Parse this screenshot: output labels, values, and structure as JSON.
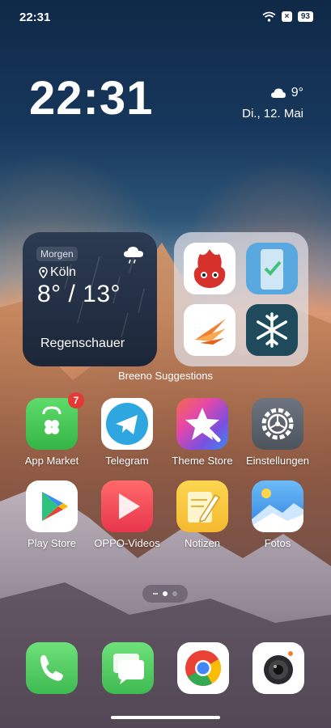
{
  "status_bar": {
    "time": "22:31",
    "battery": "93",
    "sim_indicator": "×"
  },
  "lockclock": {
    "time": "22:31",
    "weather_temp": "9°",
    "weather_icon": "cloud-icon",
    "date": "Di., 12. Mai"
  },
  "weather_widget": {
    "pill": "Morgen",
    "city": "Köln",
    "temp_range": "8° / 13°",
    "condition": "Regenschauer",
    "icon": "rain-cloud-icon"
  },
  "folder": {
    "label": "Breeno Suggestions",
    "apps": [
      "antutu-icon",
      "phone-clone-icon",
      "swift-icon",
      "snowflake-icon"
    ]
  },
  "apps_row1": [
    {
      "label": "App Market",
      "badge": "7"
    },
    {
      "label": "Telegram"
    },
    {
      "label": "Theme Store"
    },
    {
      "label": "Einstellungen"
    }
  ],
  "apps_row2": [
    {
      "label": "Play Store"
    },
    {
      "label": "OPPO-Videos"
    },
    {
      "label": "Notizen"
    },
    {
      "label": "Fotos"
    }
  ],
  "page_indicator": {
    "pages": 2,
    "active": 1
  },
  "dock": [
    "Phone",
    "Messages",
    "Chrome",
    "Camera"
  ],
  "colors": {
    "app_market": "#4cd05b",
    "telegram_blue": "#2ea6e0",
    "theme_store": "#7a4fe0",
    "settings_gray": "#5f6671",
    "videos_red": "#f0505a",
    "notes_yellow": "#f7c843",
    "photos_blue": "#4a9bf0"
  }
}
